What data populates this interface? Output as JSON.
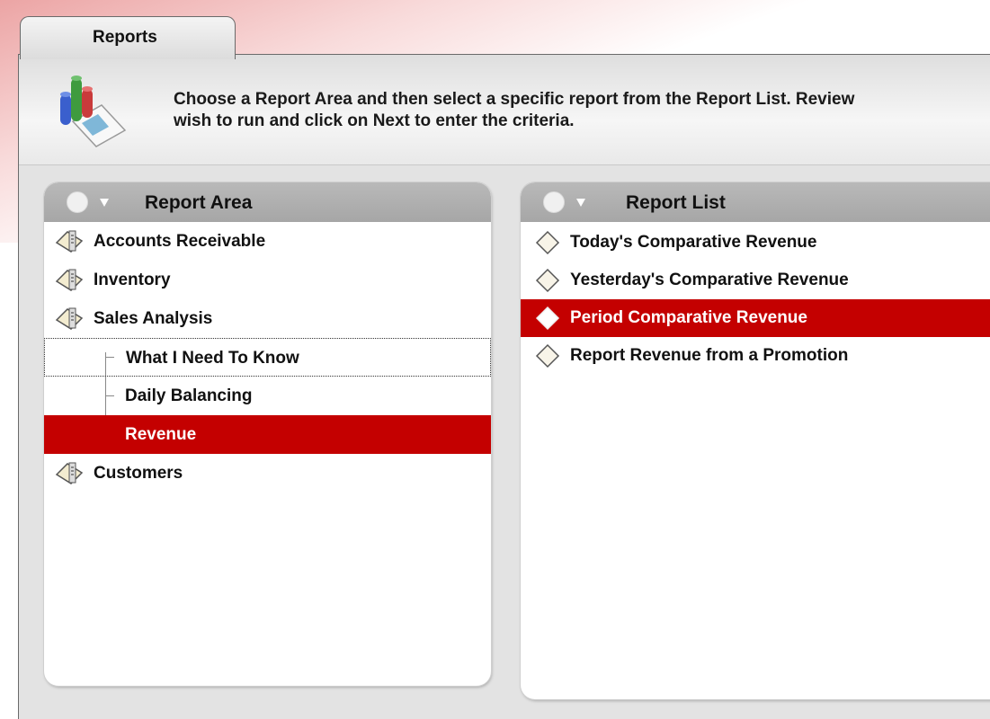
{
  "tab": {
    "label": "Reports"
  },
  "header": {
    "line1": "Choose a Report Area and then select a specific report from the Report List. Review",
    "line2": "wish to run and click on Next to enter the criteria."
  },
  "report_area": {
    "title": "Report Area",
    "items": [
      {
        "label": "Accounts Receivable",
        "level": 0
      },
      {
        "label": "Inventory",
        "level": 0
      },
      {
        "label": "Sales Analysis",
        "level": 0
      },
      {
        "label": "What I Need To Know",
        "level": 1,
        "focused": true
      },
      {
        "label": "Daily Balancing",
        "level": 1
      },
      {
        "label": "Revenue",
        "level": 1,
        "selected": true
      },
      {
        "label": "Customers",
        "level": 0
      }
    ]
  },
  "report_list": {
    "title": "Report List",
    "items": [
      {
        "label": "Today's Comparative Revenue"
      },
      {
        "label": "Yesterday's Comparative Revenue"
      },
      {
        "label": "Period Comparative Revenue",
        "selected": true
      },
      {
        "label": "Report Revenue from a Promotion"
      }
    ]
  },
  "colors": {
    "selection": "#c40000",
    "panel_header": "#b0b0b0",
    "accent": "#dc5a5a"
  }
}
